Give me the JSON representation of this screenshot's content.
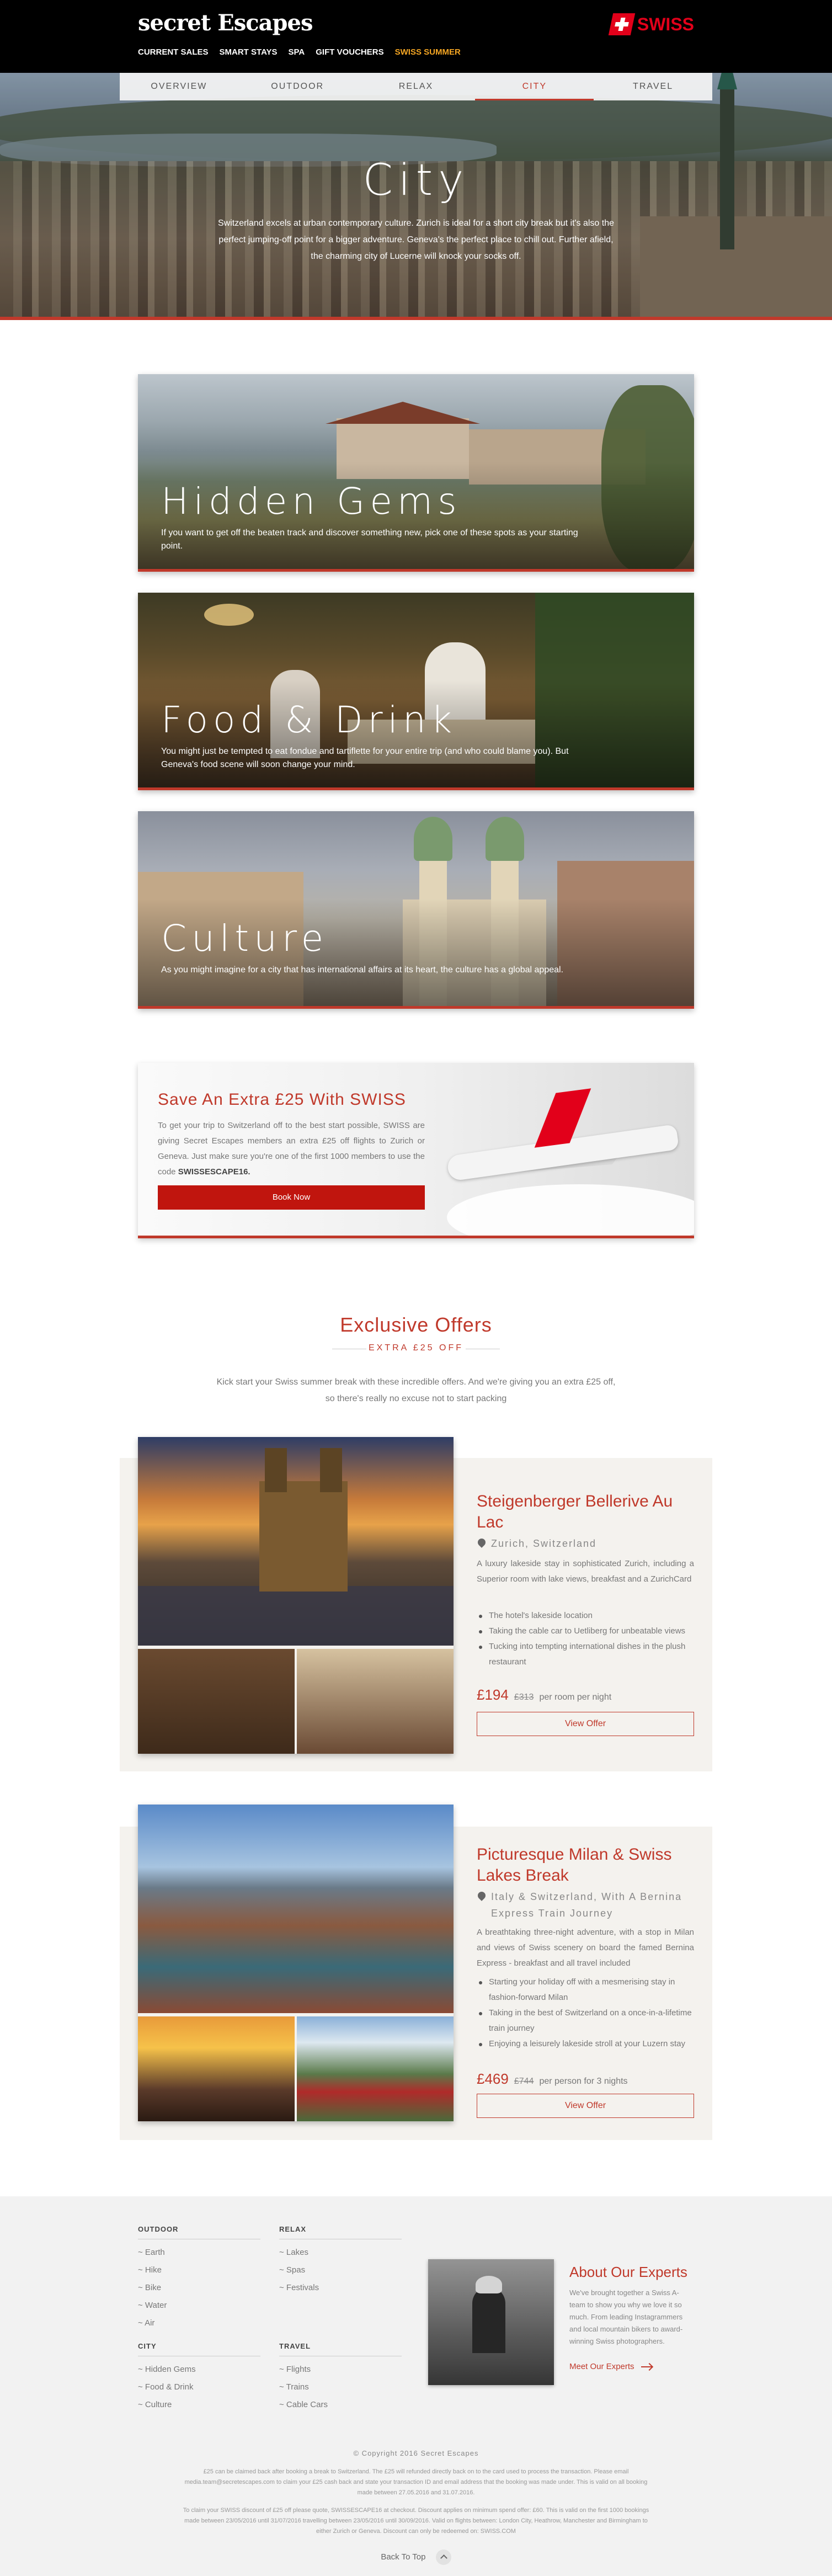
{
  "header": {
    "logo": "secret Escapes",
    "nav": [
      "CURRENT SALES",
      "SMART STAYS",
      "SPA",
      "GIFT VOUCHERS",
      "SWISS SUMMER"
    ],
    "partner": "SWISS",
    "colors": {
      "background": "#000000",
      "highlight": "#f5a623",
      "partner_red": "#e2001a"
    }
  },
  "subnav": [
    "OVERVIEW",
    "OUTDOOR",
    "RELAX",
    "CITY",
    "TRAVEL"
  ],
  "hero": {
    "title": "City",
    "text": "Switzerland excels at urban contemporary culture. Zurich is ideal for a short city break but it's also the perfect jumping-off point for a bigger adventure. Geneva's the perfect place to chill out. Further afield, the charming city of Lucerne will knock your socks off."
  },
  "categories": [
    {
      "title": "Hidden Gems",
      "text": "If you want to get off the beaten track and discover something new, pick one of these spots as your starting point."
    },
    {
      "title": "Food & Drink",
      "text": "You might just be tempted to eat fondue and tartiflette for your entire trip (and who could blame you). But Geneva's food scene will soon change your mind."
    },
    {
      "title": "Culture",
      "text": "As you might imagine for a city that has international affairs at its heart, the culture has a global appeal."
    }
  ],
  "promo": {
    "title": "Save An Extra £25 With SWISS",
    "text": "To get your trip to Switzerland off to the best start possible, SWISS are giving Secret Escapes members an extra £25 off flights to Zurich or Geneva. Just make sure you're one of the first 1000 members to use the code",
    "code": "SWISSESCAPE16.",
    "button": "Book Now"
  },
  "exclusive": {
    "title": "Exclusive Offers",
    "subtitle": "EXTRA £25 OFF",
    "text": "Kick start your Swiss summer break with these incredible offers. And we're giving you an extra £25 off, so there's really no excuse not to start packing"
  },
  "offers": [
    {
      "title": "Steigenberger Bellerive Au Lac",
      "location": "Zurich, Switzerland",
      "description": "A luxury lakeside stay in sophisticated Zurich, including a Superior room with lake views, breakfast and a ZurichCard",
      "bullets": [
        "The hotel's lakeside location",
        "Taking the cable car to Uetliberg for unbeatable views",
        "Tucking into tempting international dishes in the plush restaurant"
      ],
      "price": "£194",
      "was": "£313",
      "per": "per room per night",
      "button": "View Offer"
    },
    {
      "title": "Picturesque Milan & Swiss Lakes Break",
      "location": "Italy & Switzerland, With A Bernina Express Train Journey",
      "description": "A breathtaking three-night adventure, with a stop in Milan and views of Swiss scenery on board the famed Bernina Express - breakfast and all travel included",
      "bullets": [
        "Starting your holiday off with a mesmerising stay in fashion-forward Milan",
        "Taking in the best of Switzerland on a once-in-a-lifetime train journey",
        "Enjoying a leisurely lakeside stroll at your Luzern stay"
      ],
      "price": "£469",
      "was": "£744",
      "per": "per person for 3 nights",
      "button": "View Offer"
    }
  ],
  "footer": {
    "columns": [
      {
        "heading": "OUTDOOR",
        "items": [
          "~ Earth",
          "~ Hike",
          "~ Bike",
          "~ Water",
          "~ Air"
        ]
      },
      {
        "heading": "RELAX",
        "items": [
          "~ Lakes",
          "~ Spas",
          "~ Festivals"
        ]
      },
      {
        "heading": "CITY",
        "items": [
          "~ Hidden Gems",
          "~ Food & Drink",
          "~ Culture"
        ]
      },
      {
        "heading": "TRAVEL",
        "items": [
          "~ Flights",
          "~ Trains",
          "~ Cable Cars"
        ]
      }
    ],
    "experts": {
      "title": "About Our Experts",
      "text": "We've brought together a Swiss A-team to show you why we love it so much. From leading Instagrammers and local mountain bikers to award-winning Swiss photographers.",
      "link": "Meet Our Experts"
    },
    "copyright": "© Copyright 2016 Secret Escapes",
    "fine1": "£25 can be claimed back after booking a break to Switzerland. The £25 will refunded directly back on to the card used to process the transaction. Please email media.team@secretescapes.com to claim your £25 cash back and state your transaction ID and email address that the booking was made under. This is valid on all booking made between 27.05.2016 and 31.07.2016.",
    "fine2": "To claim your SWISS discount of £25 off please quote, SWISSESCAPE16 at checkout. Discount applies on minimum spend offer: £60. This is valid on the first 1000 bookings made between 23/05/2016 until 31/07/2016 travelling between 23/05/2016 until 30/09/2016. Valid on flights between: London City, Heathrow, Manchester and Birmingham to either Zurich or Geneva. Discount can only be redeemed on: SWISS.COM",
    "back_to_top": "Back To Top"
  }
}
